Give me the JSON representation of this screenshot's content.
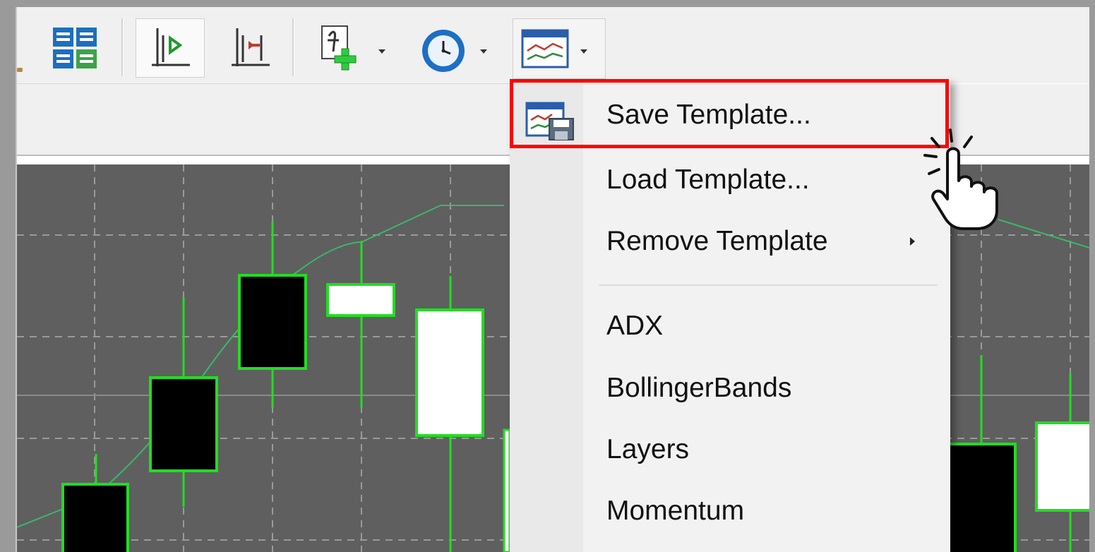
{
  "toolbar": {
    "buttons": [
      {
        "name": "data-window-icon"
      },
      {
        "name": "autoscroll-icon"
      },
      {
        "name": "chart-shift-icon"
      },
      {
        "name": "indicators-icon"
      },
      {
        "name": "periodicity-icon"
      },
      {
        "name": "templates-icon"
      }
    ]
  },
  "menu": {
    "items": [
      {
        "label": "Save Template...",
        "highlighted": true
      },
      {
        "label": "Load Template..."
      },
      {
        "label": "Remove Template",
        "submenu": true
      },
      {
        "label": "ADX"
      },
      {
        "label": "BollingerBands"
      },
      {
        "label": "Layers"
      },
      {
        "label": "Momentum"
      }
    ]
  },
  "colors": {
    "chart_background": "#606060",
    "candle_outline": "#22dd22",
    "highlight_box": "#ff0000",
    "grid": "#9a9a9a"
  }
}
